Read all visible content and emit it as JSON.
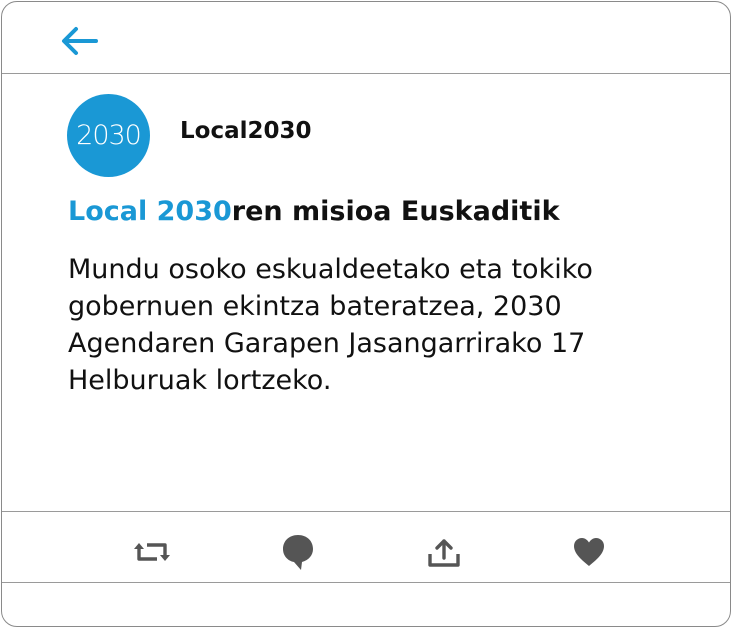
{
  "header": {
    "back_icon": "arrow-left-icon",
    "accent": "#1a98d5"
  },
  "profile": {
    "avatar_text": "2030",
    "name": "Local2030"
  },
  "post": {
    "title_accent": "Local 2030",
    "title_rest": "ren misioa Euskaditik",
    "body": "Mundu osoko eskualdeetako eta tokiko gobernuen ekintza bateratzea, 2030 Agendaren Garapen Jasangarrirako 17 Helburuak lortzeko."
  },
  "actions": [
    {
      "icon": "retweet-icon"
    },
    {
      "icon": "reply-icon"
    },
    {
      "icon": "share-icon"
    },
    {
      "icon": "like-icon"
    }
  ]
}
